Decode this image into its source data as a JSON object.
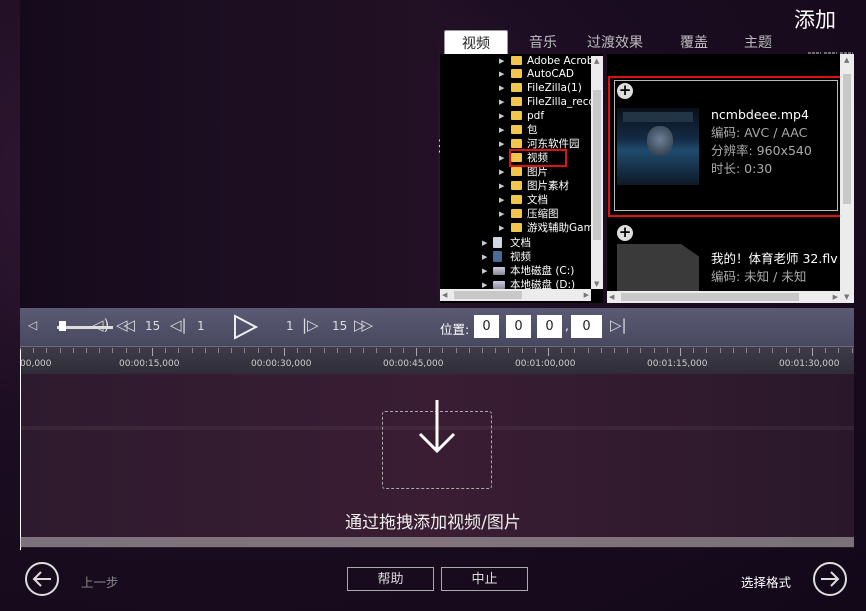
{
  "header": {
    "title": "添加"
  },
  "tabs": [
    {
      "label": "视频",
      "active": true
    },
    {
      "label": "音乐",
      "active": false
    },
    {
      "label": "过渡效果",
      "active": false
    },
    {
      "label": "覆盖",
      "active": false
    },
    {
      "label": "主题",
      "active": false
    }
  ],
  "tree": {
    "items": [
      {
        "label": "Adobe Acrobat",
        "type": "folder"
      },
      {
        "label": "AutoCAD",
        "type": "folder"
      },
      {
        "label": "FileZilla(1)",
        "type": "folder"
      },
      {
        "label": "FileZilla_recover",
        "type": "folder"
      },
      {
        "label": "pdf",
        "type": "folder"
      },
      {
        "label": "包",
        "type": "folder"
      },
      {
        "label": "河东软件园",
        "type": "folder"
      },
      {
        "label": "视频",
        "type": "folder",
        "selected": true
      },
      {
        "label": "图片",
        "type": "folder"
      },
      {
        "label": "图片素材",
        "type": "folder"
      },
      {
        "label": "文档",
        "type": "folder"
      },
      {
        "label": "压缩图",
        "type": "folder"
      },
      {
        "label": "游戏辅助Games",
        "type": "folder"
      },
      {
        "label": "文档",
        "type": "library"
      },
      {
        "label": "视频",
        "type": "library"
      },
      {
        "label": "本地磁盘 (C:)",
        "type": "drive"
      },
      {
        "label": "本地磁盘 (D:)",
        "type": "drive"
      }
    ]
  },
  "media": {
    "items": [
      {
        "name": "ncmbdeee.mp4",
        "codec": "编码: AVC / AAC",
        "resolution": "分辨率: 960x540",
        "duration": "时长: 0:30"
      },
      {
        "name": "我的！体育老师 32.flv",
        "codec": "编码: 未知 / 未知"
      }
    ]
  },
  "controls": {
    "skip_back_big": "15",
    "skip_back_small": "1",
    "skip_fwd_small": "1",
    "skip_fwd_big": "15",
    "position_label": "位置:",
    "position": [
      "0",
      "0",
      "0",
      "0"
    ],
    "position_sep": ","
  },
  "ruler": {
    "labels": [
      "00,000",
      "00:00:15,000",
      "00:00:30,000",
      "00:00:45,000",
      "00:01:00,000",
      "00:01:15,000",
      "00:01:30,000"
    ]
  },
  "timeline": {
    "drop_text": "通过拖拽添加视频/图片"
  },
  "footer": {
    "back_label": "上一步",
    "help_label": "帮助",
    "abort_label": "中止",
    "next_label": "选择格式"
  },
  "colors": {
    "highlight": "#dd1111",
    "folder": "#f2c64c"
  }
}
